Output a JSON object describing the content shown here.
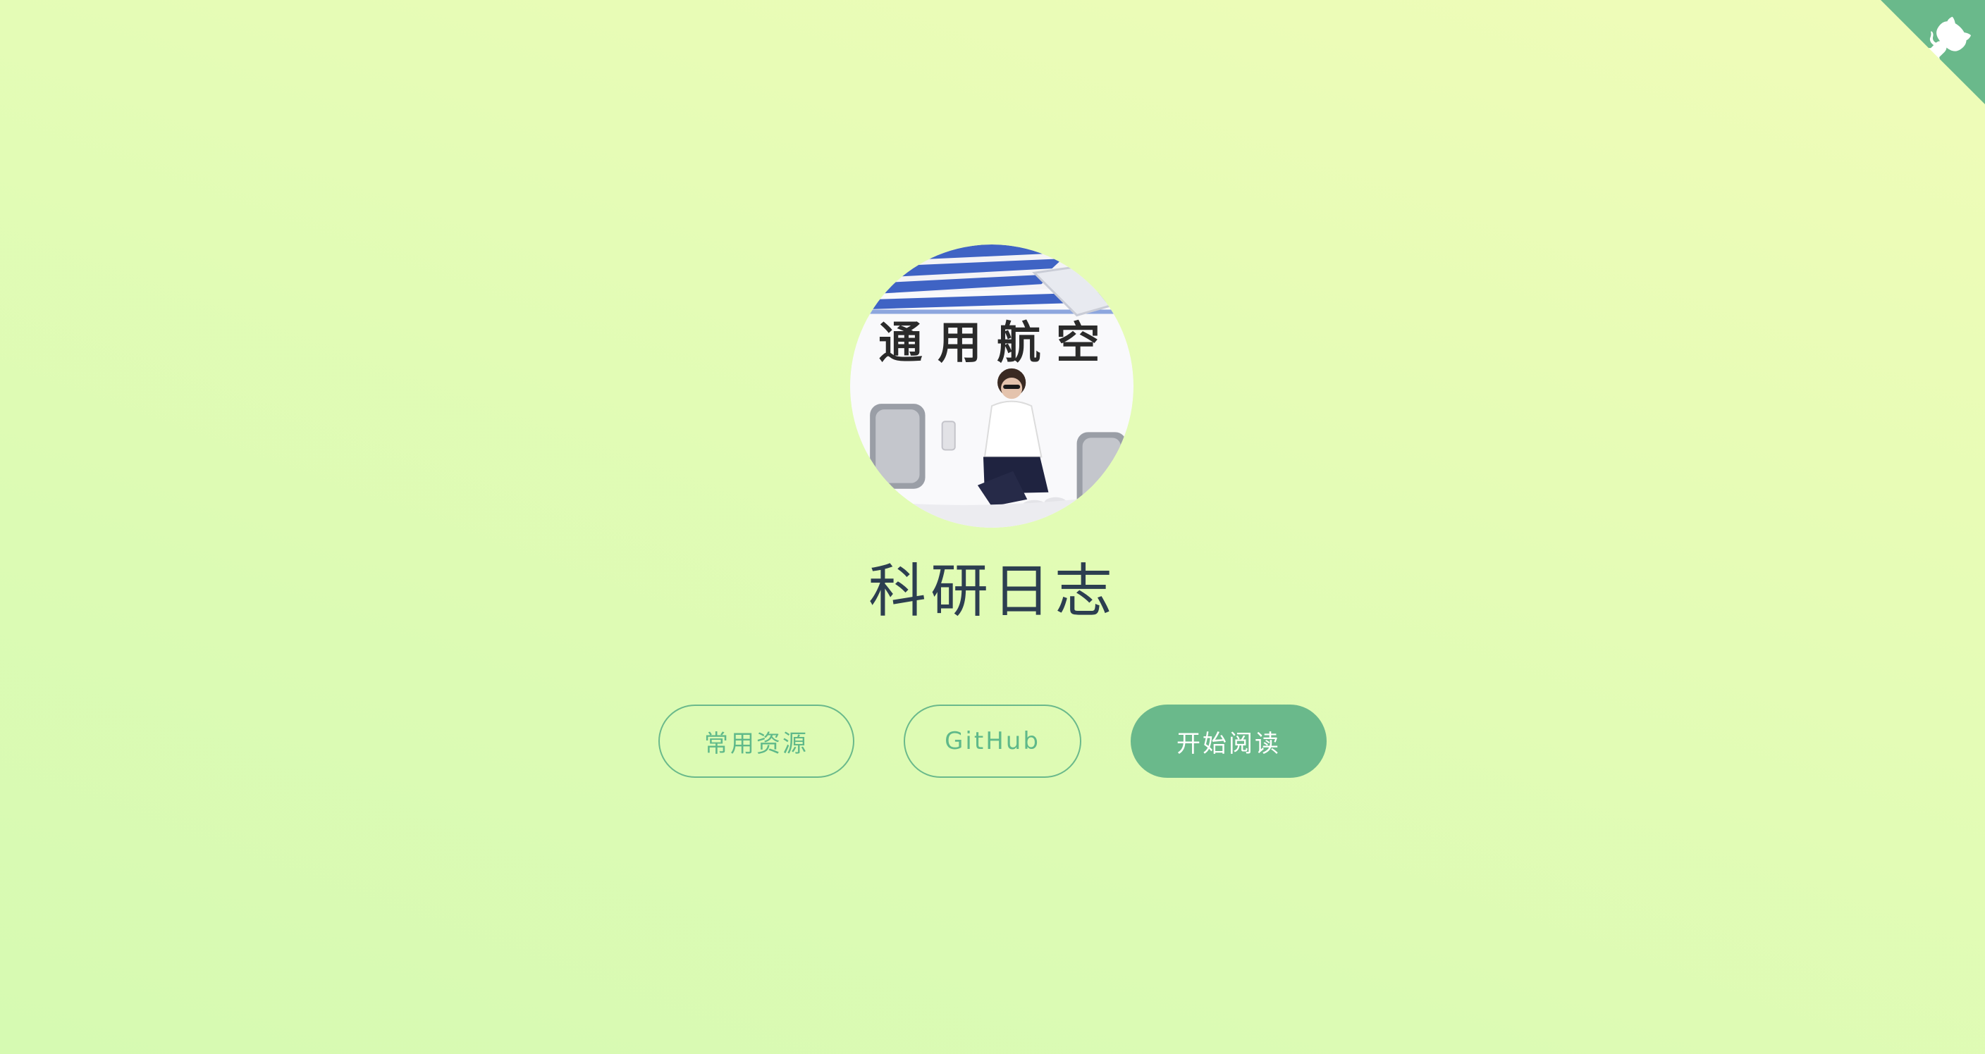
{
  "cover": {
    "title": "科研日志",
    "avatar_sign_text": "通 用 航 空",
    "buttons": {
      "resources": "常用资源",
      "github": "GitHub",
      "start": "开始阅读"
    }
  },
  "corner": {
    "icon": "github-octocat-icon",
    "color": "#6ab98b"
  },
  "colors": {
    "accent": "#42b983",
    "title": "#2c3e50",
    "background_start": "#f0fcb8",
    "background_end": "#d6fab2"
  }
}
